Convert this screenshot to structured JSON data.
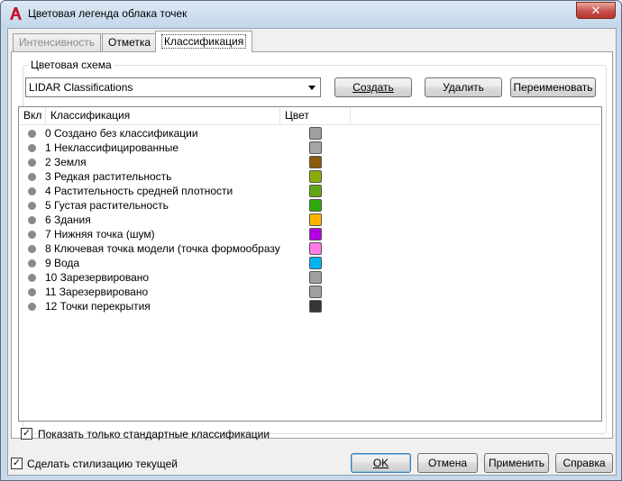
{
  "window": {
    "title": "Цветовая легенда облака точек",
    "close_label": "✕"
  },
  "tabs": [
    {
      "label": "Интенсивность",
      "state": "disabled"
    },
    {
      "label": "Отметка",
      "state": "normal"
    },
    {
      "label": "Классификация",
      "state": "active"
    }
  ],
  "scheme": {
    "label": "Цветовая схема",
    "selected": "LIDAR Classifications",
    "create_label": "Создать",
    "delete_label": "Удалить",
    "rename_label": "Переименовать"
  },
  "table": {
    "columns": [
      "Вкл",
      "Классификация",
      "Цвет"
    ],
    "rows": [
      {
        "label": "0 Создано без классификации",
        "color": "#a0a0a0"
      },
      {
        "label": "1 Неклассифицированные",
        "color": "#a5a5a5"
      },
      {
        "label": "2 Земля",
        "color": "#8c5a0a"
      },
      {
        "label": "3 Редкая растительность",
        "color": "#8aac0a"
      },
      {
        "label": "4 Растительность средней плотности",
        "color": "#5fa814"
      },
      {
        "label": "5 Густая растительность",
        "color": "#2ea80a"
      },
      {
        "label": "6 Здания",
        "color": "#ffb400"
      },
      {
        "label": "7 Нижняя точка (шум)",
        "color": "#b400e6"
      },
      {
        "label": "8 Ключевая точка модели (точка формообразу",
        "color": "#ff7ae6"
      },
      {
        "label": "9 Вода",
        "color": "#00b4f0"
      },
      {
        "label": "10 Зарезервировано",
        "color": "#a0a0a0"
      },
      {
        "label": "11 Зарезервировано",
        "color": "#a0a0a0"
      },
      {
        "label": "12 Точки перекрытия",
        "color": "#353535"
      }
    ]
  },
  "options": {
    "show_standard_label": "Показать только стандартные классификации",
    "show_standard_checked": "✓",
    "make_current_label": "Сделать стилизацию текущей",
    "make_current_checked": "✓"
  },
  "buttons": {
    "ok": "OK",
    "cancel": "Отмена",
    "apply": "Применить",
    "help": "Справка"
  }
}
